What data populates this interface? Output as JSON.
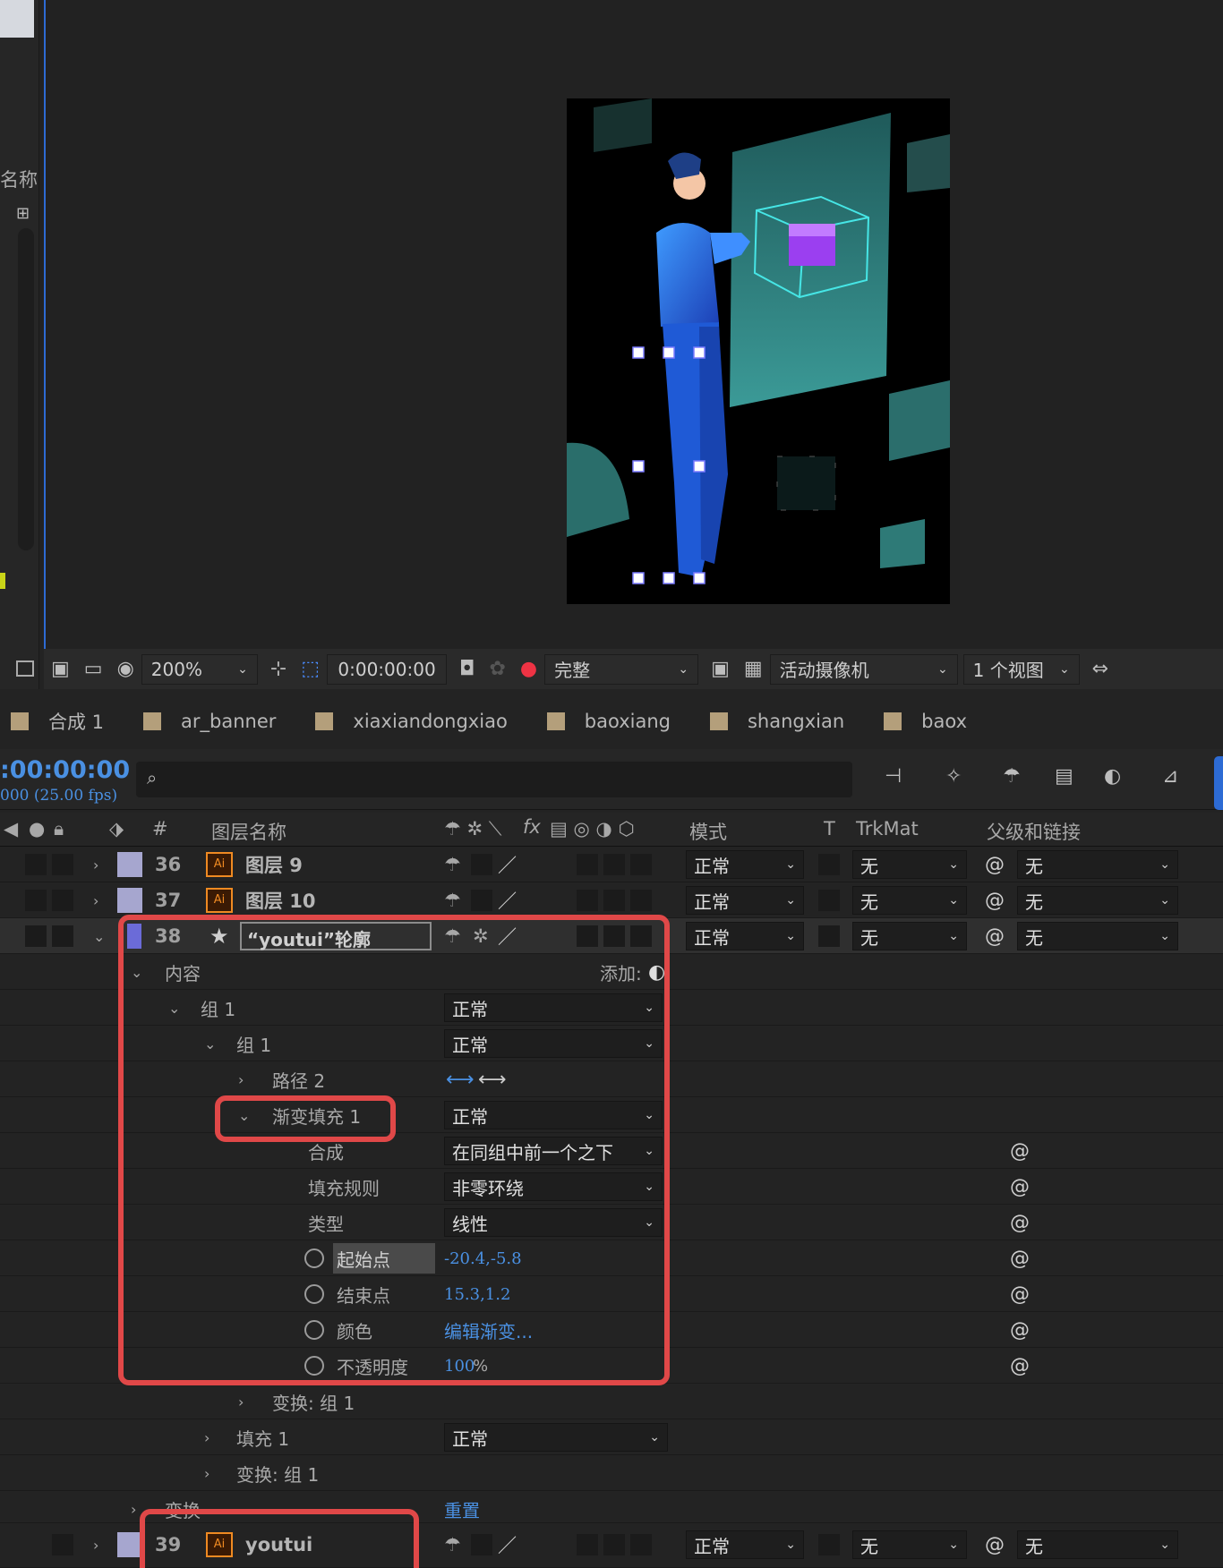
{
  "viewer": {
    "zoom": "200%",
    "timecode": "0:00:00:00",
    "resolution": "完整",
    "camera": "活动摄像机",
    "views": "1 个视图"
  },
  "left_panel": {
    "name_header": "名称"
  },
  "tabs": [
    {
      "label": "合成 1",
      "active": true
    },
    {
      "label": "ar_banner"
    },
    {
      "label": "xiaxiandongxiao"
    },
    {
      "label": "baoxiang"
    },
    {
      "label": "shangxian"
    },
    {
      "label": "baox"
    }
  ],
  "timeline": {
    "current_time": ":00:00:00",
    "fps": "000 (25.00 fps)",
    "search_placeholder": "",
    "columns": {
      "num": "#",
      "layer_name": "图层名称",
      "fx": "fx",
      "mode": "模式",
      "t": "T",
      "trkmat": "TrkMat",
      "parent": "父级和链接"
    },
    "layers": [
      {
        "num": "36",
        "name": "图层 9",
        "mode": "正常",
        "trkmat": "无",
        "parent": "无"
      },
      {
        "num": "37",
        "name": "图层 10",
        "mode": "正常",
        "trkmat": "无",
        "parent": "无"
      },
      {
        "num": "38",
        "name": "“youtui”轮廓",
        "mode": "正常",
        "trkmat": "无",
        "parent": "无"
      },
      {
        "num": "39",
        "name": "youtui",
        "mode": "正常",
        "trkmat": "无",
        "parent": "无"
      }
    ],
    "tree": {
      "content": "内容",
      "add": "添加:",
      "group1": "组 1",
      "group1_mode": "正常",
      "group1b": "组 1",
      "group1b_mode": "正常",
      "path2": "路径 2",
      "gradfill": "渐变填充 1",
      "gradfill_mode": "正常",
      "composite": "合成",
      "composite_val": "在同组中前一个之下",
      "fillrule": "填充规则",
      "fillrule_val": "非零环绕",
      "type": "类型",
      "type_val": "线性",
      "start": "起始点",
      "start_val": "-20.4,-5.8",
      "end": "结束点",
      "end_val": "15.3,1.2",
      "color": "颜色",
      "color_val": "编辑渐变...",
      "opacity": "不透明度",
      "opacity_val": "100",
      "opacity_unit": "%",
      "xform_g1": "变换: 组 1",
      "fill1": "填充 1",
      "fill1_mode": "正常",
      "xform_g1b": "变换: 组 1",
      "transform": "变换",
      "reset": "重置"
    }
  },
  "colors": {
    "accent": "#2d6bd4",
    "highlight": "#e04848",
    "value_blue": "#4a90e2",
    "label_purple": "#a6a6cf"
  }
}
